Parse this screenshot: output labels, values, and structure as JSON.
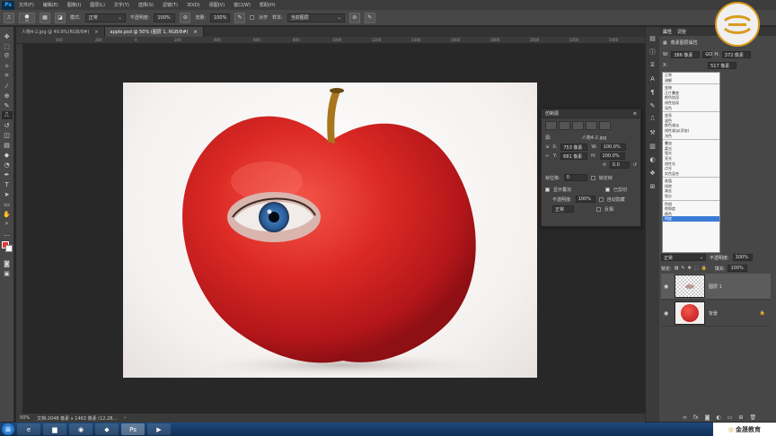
{
  "menubar": {
    "logo": "Ps",
    "items": [
      "文件(F)",
      "编辑(E)",
      "图像(I)",
      "图层(L)",
      "文字(Y)",
      "选择(S)",
      "滤镜(T)",
      "3D(D)",
      "视图(V)",
      "窗口(W)",
      "帮助(H)"
    ]
  },
  "options": {
    "brush_size": "55",
    "mode_label": "模式:",
    "mode_value": "正常",
    "opacity_label": "不透明度:",
    "opacity_value": "100%",
    "flow_label": "流量:",
    "flow_value": "100%",
    "aligned_label": "对齐",
    "sample_label": "样本:",
    "sample_value": "当前图层"
  },
  "tabs": [
    {
      "label": "人物4-2.jpg @ 40.8%(RGB/8#)"
    },
    {
      "label": "apple.psd @ 50% (图层 1, RGB/8#)"
    }
  ],
  "ruler_ticks": [
    "400",
    "200",
    "0",
    "200",
    "400",
    "600",
    "800",
    "1000",
    "1200",
    "1400",
    "1600",
    "1800",
    "2000",
    "2200",
    "2400"
  ],
  "status": {
    "zoom": "50%",
    "doc_info": "文档:2048 像素 x 1463 像素 (12.28..."
  },
  "clone_panel": {
    "title": "仿制源",
    "source_label": "源:",
    "source_file": "人物4-2.jpg",
    "x_label": "X:",
    "x_value": "753 像素",
    "y_label": "Y:",
    "y_value": "681 像素",
    "w_label": "W:",
    "w_value": "100.0%",
    "h_label": "H:",
    "h_value": "100.0%",
    "angle_value": "0.0",
    "frame_offset_label": "帧位移:",
    "frame_offset_value": "0",
    "lock_frame_label": "锁定帧",
    "show_overlay_label": "显示叠加",
    "clipped_label": "已剪切",
    "opacity_label": "不透明度:",
    "opacity_value": "100%",
    "auto_hide_label": "自动隐藏",
    "mode_value": "正常",
    "invert_label": "反相"
  },
  "right_panel": {
    "tabs": [
      "属性",
      "调整"
    ],
    "properties_title": "像素图层属性",
    "w_label": "W:",
    "w_value": "386 像素",
    "go_label": "GO",
    "h_label": "H:",
    "h_value": "372 像素",
    "x_label": "X:",
    "y_value": "517 像素"
  },
  "blend_modes": {
    "groups": [
      [
        "正常",
        "溶解"
      ],
      [
        "变暗",
        "正片叠底",
        "颜色加深",
        "线性加深",
        "深色"
      ],
      [
        "变亮",
        "滤色",
        "颜色减淡",
        "线性减淡(添加)",
        "浅色"
      ],
      [
        "叠加",
        "柔光",
        "强光",
        "亮光",
        "线性光",
        "点光",
        "实色混合"
      ],
      [
        "差值",
        "排除",
        "减去",
        "划分"
      ],
      [
        "色相",
        "饱和度",
        "颜色",
        "明度"
      ]
    ],
    "selected": "明度"
  },
  "layers_panel": {
    "mode_value": "正常",
    "opacity_label": "不透明度:",
    "opacity_value": "100%",
    "lock_label": "锁定:",
    "fill_label": "填充:",
    "fill_value": "100%",
    "layers": [
      {
        "name": "图层 1"
      },
      {
        "name": "背景"
      }
    ]
  },
  "brand": {
    "text": "金晟教育"
  },
  "colors": {
    "accent": "#31a8ff",
    "foreground": "#e8312d",
    "background": "#ffffff",
    "selection": "#3a7bd5"
  }
}
